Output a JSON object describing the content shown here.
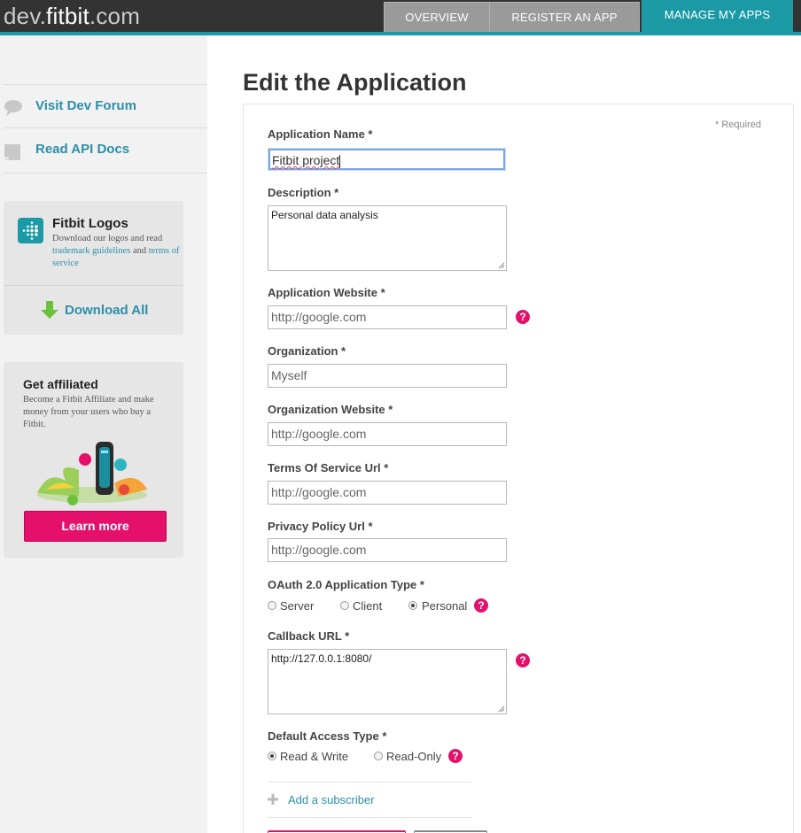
{
  "header": {
    "logo_prefix": "dev.",
    "logo_main": "fitbit",
    "logo_suffix": ".com",
    "tabs": [
      {
        "label": "OVERVIEW"
      },
      {
        "label": "REGISTER AN APP"
      },
      {
        "label": "MANAGE MY APPS"
      }
    ],
    "accent_color": "#1b9aa5"
  },
  "sidebar": {
    "links": [
      {
        "label": "Visit Dev Forum",
        "icon": "speech-bubble-icon"
      },
      {
        "label": "Read API Docs",
        "icon": "document-icon"
      }
    ],
    "logos_card": {
      "title": "Fitbit Logos",
      "text_before": "Download our logos and read ",
      "link1": "trademark guidelines",
      "text_mid": " and ",
      "link2": "terms of service",
      "download_label": "Download All"
    },
    "affiliate_card": {
      "title": "Get affiliated",
      "text": "Become a Fitbit Affiliate and make money from your users who buy a Fitbit.",
      "button_label": "Learn more"
    }
  },
  "main": {
    "title": "Edit the Application",
    "required_note": "* Required",
    "fields": {
      "app_name": {
        "label": "Application Name *",
        "value": "Fitbit project"
      },
      "description": {
        "label": "Description *",
        "value": "Personal data analysis"
      },
      "app_website": {
        "label": "Application Website *",
        "value": "http://google.com"
      },
      "organization": {
        "label": "Organization *",
        "value": "Myself"
      },
      "org_website": {
        "label": "Organization Website *",
        "value": "http://google.com"
      },
      "tos_url": {
        "label": "Terms Of Service Url *",
        "value": "http://google.com"
      },
      "privacy_url": {
        "label": "Privacy Policy Url *",
        "value": "http://google.com"
      },
      "oauth_type": {
        "label": "OAuth 2.0 Application Type *",
        "options": [
          "Server",
          "Client",
          "Personal"
        ],
        "selected": "Personal"
      },
      "callback_url": {
        "label": "Callback URL *",
        "value": "http://127.0.0.1:8080/"
      },
      "access_type": {
        "label": "Default Access Type *",
        "options": [
          "Read & Write",
          "Read-Only"
        ],
        "selected": "Read & Write"
      }
    },
    "help_glyph": "?",
    "add_subscriber": "Add a subscriber",
    "help_color": "#e5106b"
  }
}
